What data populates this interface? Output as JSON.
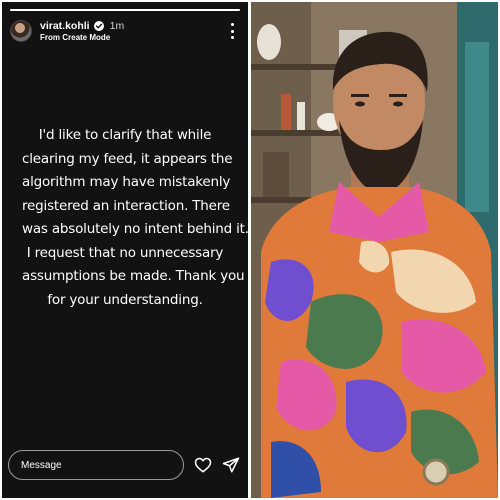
{
  "story": {
    "username": "virat.kohli",
    "time_ago": "1m",
    "subtitle": "From Create Mode",
    "progress": 1.0,
    "text_lines": [
      "I'd like to clarify that while",
      "clearing my feed, it appears the",
      "algorithm may have mistakenly",
      "registered an interaction. There",
      "was absolutely no intent behind it.",
      "I request that no unnecessary",
      "assumptions be made. Thank you",
      "for your understanding."
    ],
    "message_placeholder": "Message",
    "icons": {
      "verified": "verified-badge-icon",
      "more": "more-options-icon",
      "like": "heart-icon",
      "send": "send-icon"
    }
  },
  "colors": {
    "story_background": "#121212",
    "text": "#ffffff",
    "verified": "#3897f0"
  }
}
